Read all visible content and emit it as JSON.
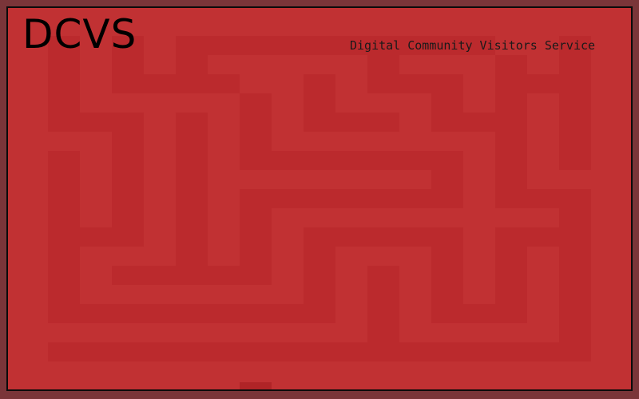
{
  "header": {
    "title": "DCVS",
    "subtitle": "Digital Community Visitors Service"
  },
  "colors": {
    "background": "#c13133",
    "maze_path": "#bb2a2d",
    "outer_frame": "#7a3539",
    "border": "#0b0b0b"
  }
}
